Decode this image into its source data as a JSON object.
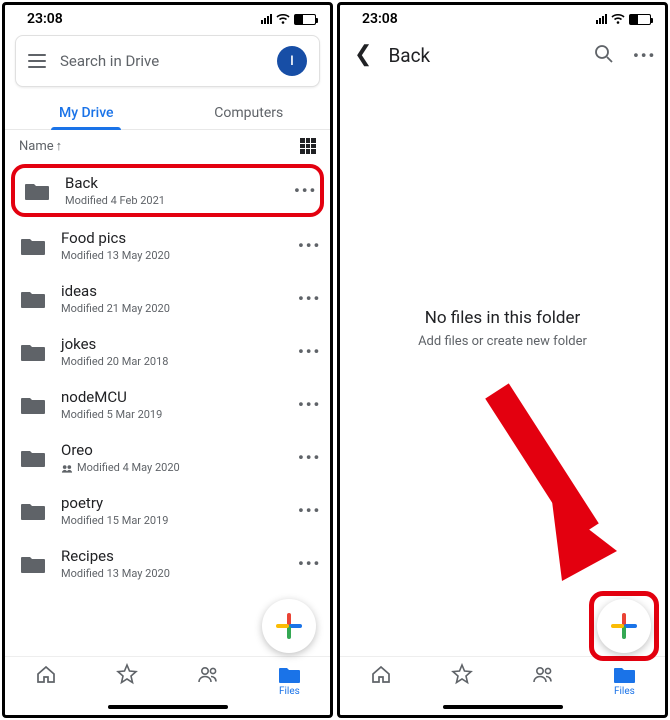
{
  "status": {
    "time": "23:08"
  },
  "left": {
    "search_placeholder": "Search in Drive",
    "avatar_initial": "I",
    "tabs": {
      "my_drive": "My Drive",
      "computers": "Computers"
    },
    "sort_label": "Name",
    "folders": [
      {
        "name": "Back",
        "sub": "Modified 4 Feb 2021",
        "highlighted": true,
        "shared": false
      },
      {
        "name": "Food pics",
        "sub": "Modified 13 May 2020",
        "highlighted": false,
        "shared": false
      },
      {
        "name": "ideas",
        "sub": "Modified 21 May 2020",
        "highlighted": false,
        "shared": false
      },
      {
        "name": "jokes",
        "sub": "Modified 20 Mar 2018",
        "highlighted": false,
        "shared": false
      },
      {
        "name": "nodeMCU",
        "sub": "Modified 5 Mar 2019",
        "highlighted": false,
        "shared": false
      },
      {
        "name": "Oreo",
        "sub": "Modified 4 May 2020",
        "highlighted": false,
        "shared": true
      },
      {
        "name": "poetry",
        "sub": "Modified 15 Mar 2019",
        "highlighted": false,
        "shared": false
      },
      {
        "name": "Recipes",
        "sub": "Modified 13 May 2020",
        "highlighted": false,
        "shared": false
      }
    ]
  },
  "right": {
    "back_label": "Back",
    "empty_title": "No files in this folder",
    "empty_sub": "Add files or create new folder"
  },
  "nav": {
    "files": "Files"
  }
}
